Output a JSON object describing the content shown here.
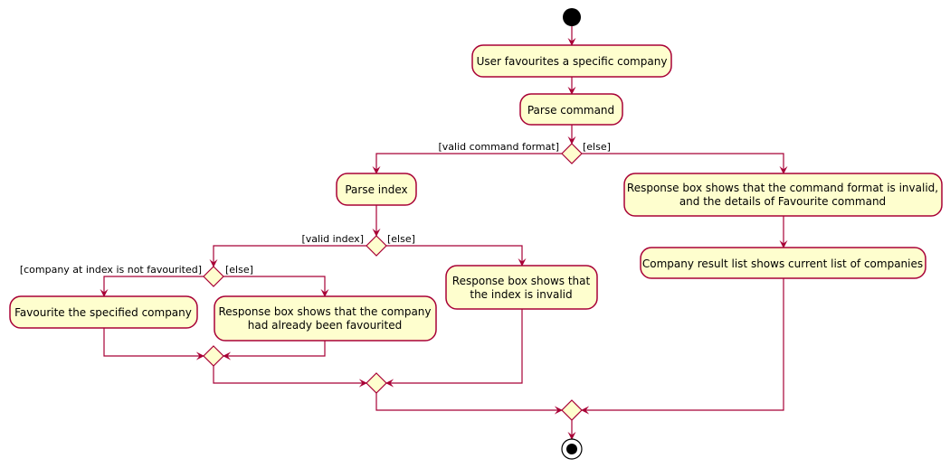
{
  "diagram": {
    "type": "activity",
    "colors": {
      "line": "#A80036",
      "fill": "#FEFECE",
      "start": "#000000"
    },
    "actions": {
      "user_favourites": [
        "User favourites a specific company"
      ],
      "parse_command": [
        "Parse command"
      ],
      "invalid_format": [
        "Response box shows that the command format is invalid,",
        "and the details of Favourite command"
      ],
      "company_list": [
        "Company result list shows current list of companies"
      ],
      "parse_index": [
        "Parse index"
      ],
      "invalid_index": [
        "Response box shows that",
        "the index is invalid"
      ],
      "favourite_company": [
        "Favourite the specified company"
      ],
      "already_favourited": [
        "Response box shows that the company",
        "had already been favourited"
      ]
    },
    "guards": {
      "valid_command_format": "[valid command format]",
      "else_format": "[else]",
      "valid_index": "[valid index]",
      "else_index": "[else]",
      "not_favourited": "[company at index is not favourited]",
      "else_favourited": "[else]"
    }
  }
}
